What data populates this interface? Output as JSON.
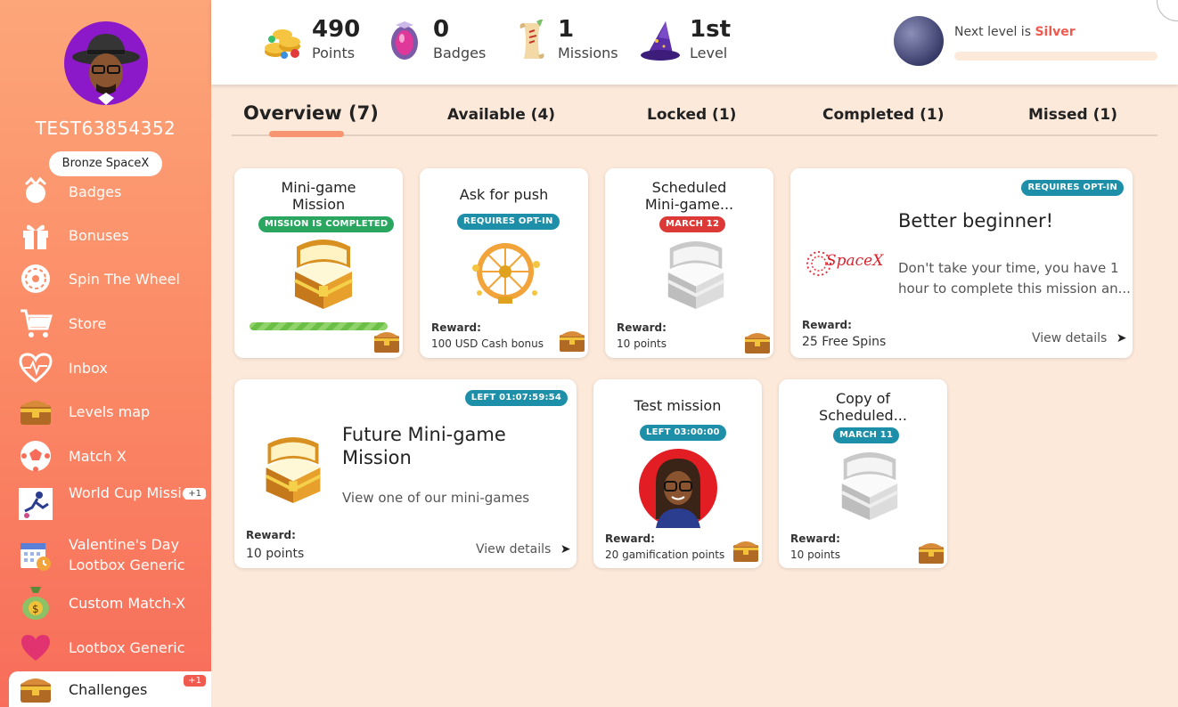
{
  "user": {
    "name": "TEST63854352",
    "level_name": "Bronze SpaceX"
  },
  "nav": [
    {
      "label": "Badges",
      "icon": "badge-icon"
    },
    {
      "label": "Bonuses",
      "icon": "gift-icon"
    },
    {
      "label": "Spin The Wheel",
      "icon": "wheel-icon"
    },
    {
      "label": "Store",
      "icon": "cart-icon"
    },
    {
      "label": "Inbox",
      "icon": "heart-pulse-icon"
    },
    {
      "label": "Levels map",
      "icon": "chest-icon"
    },
    {
      "label": "Match X",
      "icon": "soccer-ball-icon"
    },
    {
      "label": "World Cup Missions",
      "icon": "football-player-icon",
      "badge": "+1"
    },
    {
      "label": "Valentine's Day Lootbox Generic",
      "icon": "calendar-clock-icon"
    },
    {
      "label": "Custom Match-X",
      "icon": "money-bag-icon"
    },
    {
      "label": "Lootbox Generic",
      "icon": "heart-icon"
    },
    {
      "label": "Challenges",
      "icon": "chest-icon",
      "badge": "+1",
      "active": true
    }
  ],
  "stats": {
    "points": {
      "value": "490",
      "label": "Points"
    },
    "badges": {
      "value": "0",
      "label": "Badges"
    },
    "missions": {
      "value": "1",
      "label": "Missions"
    },
    "level": {
      "value": "1st",
      "label": "Level"
    }
  },
  "next_level": {
    "prefix": "Next level is",
    "name": "Silver",
    "progress": 0
  },
  "tabs": [
    {
      "label": "Overview (7)",
      "active": true
    },
    {
      "label": "Available (4)"
    },
    {
      "label": "Locked (1)"
    },
    {
      "label": "Completed (1)"
    },
    {
      "label": "Missed (1)"
    }
  ],
  "cards": {
    "c1": {
      "title_line1": "Mini-game",
      "title_line2": "Mission",
      "badge": "MISSION IS COMPLETED",
      "progress": 1.0
    },
    "c2": {
      "title": "Ask for push",
      "badge": "REQUIRES OPT-IN",
      "reward_label": "Reward:",
      "reward": "100 USD Cash bonus"
    },
    "c3": {
      "title_line1": "Scheduled",
      "title_line2": "Mini-game...",
      "badge": "MARCH 12",
      "reward_label": "Reward:",
      "reward": "10 points"
    },
    "c4": {
      "badge": "REQUIRES OPT-IN",
      "title": "Better beginner!",
      "logo_text": "SpaceX",
      "desc_line1": "Don't take your time, you have 1",
      "desc_line2": "hour to complete this mission an...",
      "reward_label": "Reward:",
      "reward": "25 Free Spins",
      "view": "View details"
    },
    "c5": {
      "badge": "LEFT 01:07:59:54",
      "title_line1": "Future Mini-game",
      "title_line2": "Mission",
      "desc": "View one of our mini-games",
      "reward_label": "Reward:",
      "reward": "10 points",
      "view": "View details"
    },
    "c6": {
      "title": "Test mission",
      "badge": "LEFT 03:00:00",
      "reward_label": "Reward:",
      "reward": "20 gamification points"
    },
    "c7": {
      "title_line1": "Copy of",
      "title_line2": "Scheduled...",
      "badge": "MARCH 11",
      "reward_label": "Reward:",
      "reward": "10 points"
    }
  },
  "colors": {
    "accent": "#f05a4f",
    "sidebar_top": "#fda67a",
    "sidebar_bottom": "#f76d5a",
    "badge_green": "#2aa660",
    "badge_blue": "#1e8fa9",
    "badge_red": "#dc3a36"
  }
}
